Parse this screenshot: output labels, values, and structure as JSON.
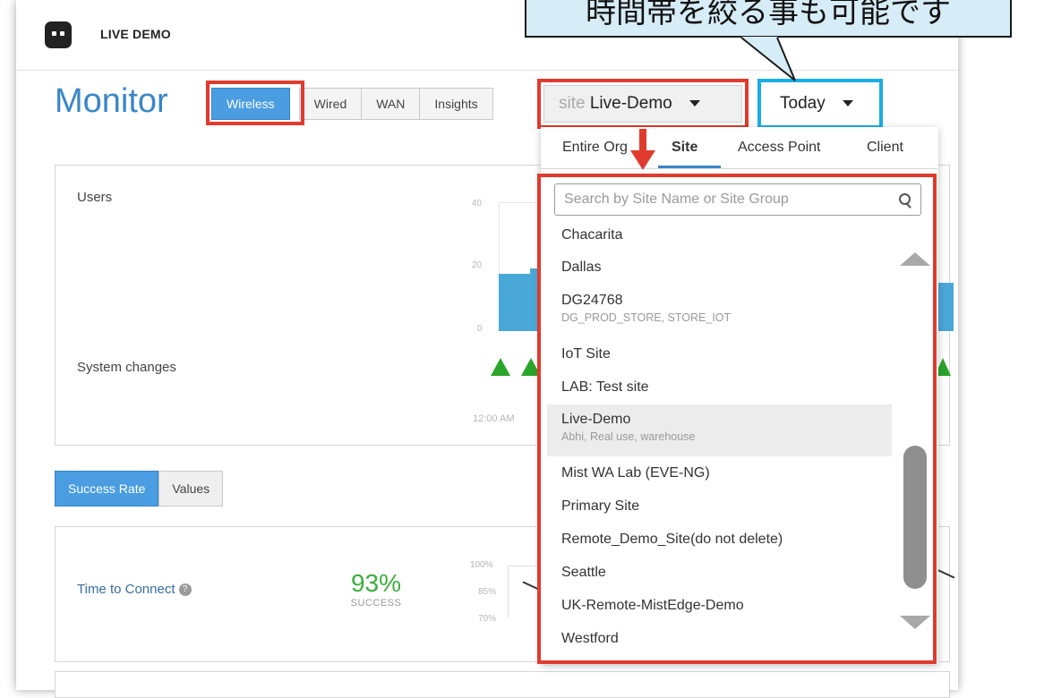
{
  "header": {
    "org_name": "LIVE DEMO"
  },
  "page": {
    "title": "Monitor"
  },
  "view_tabs": [
    {
      "label": "Wireless",
      "active": true
    },
    {
      "label": "Wired",
      "active": false
    },
    {
      "label": "WAN",
      "active": false
    },
    {
      "label": "Insights",
      "active": false
    }
  ],
  "site_selector": {
    "prefix": "site",
    "value": "Live-Demo"
  },
  "time_selector": {
    "value": "Today"
  },
  "callout": {
    "text": "時間帯を絞る事も可能です"
  },
  "chart_card": {
    "users_label": "Users",
    "system_changes_label": "System changes",
    "y_ticks": [
      "40",
      "20",
      "0"
    ],
    "x_tick": "12:00 AM"
  },
  "metric_tabs": [
    {
      "label": "Success Rate",
      "active": true
    },
    {
      "label": "Values",
      "active": false
    }
  ],
  "metric_card": {
    "label": "Time to Connect",
    "help_icon": "?",
    "value": "93%",
    "value_caption": "SUCCESS",
    "y_ticks": [
      "100%",
      "85%",
      "70%"
    ]
  },
  "dropdown": {
    "tabs": [
      {
        "label": "Entire Org",
        "active": false
      },
      {
        "label": "Site",
        "active": true
      },
      {
        "label": "Access Point",
        "active": false
      },
      {
        "label": "Client",
        "active": false
      }
    ],
    "search_placeholder": "Search by Site Name or Site Group",
    "items": [
      {
        "name": "Chacarita",
        "groups": ""
      },
      {
        "name": "Dallas",
        "groups": ""
      },
      {
        "name": "DG24768",
        "groups": "DG_PROD_STORE, STORE_IOT"
      },
      {
        "name": "IoT Site",
        "groups": ""
      },
      {
        "name": "LAB: Test site",
        "groups": ""
      },
      {
        "name": "Live-Demo",
        "groups": "Abhi, Real use, warehouse"
      },
      {
        "name": "Mist WA Lab (EVE-NG)",
        "groups": ""
      },
      {
        "name": "Primary Site",
        "groups": ""
      },
      {
        "name": "Remote_Demo_Site(do not delete)",
        "groups": ""
      },
      {
        "name": "Seattle",
        "groups": ""
      },
      {
        "name": "UK-Remote-MistEdge-Demo",
        "groups": ""
      },
      {
        "name": "Westford",
        "groups": ""
      }
    ],
    "selected_item": "Live-Demo"
  },
  "colors": {
    "accent": "#4a9de1",
    "highlight_red": "#e03b2e",
    "highlight_blue": "#19aee6",
    "bar_blue": "#4aa8d8",
    "change_green": "#2aa52a",
    "success_green": "#3cae3c"
  }
}
